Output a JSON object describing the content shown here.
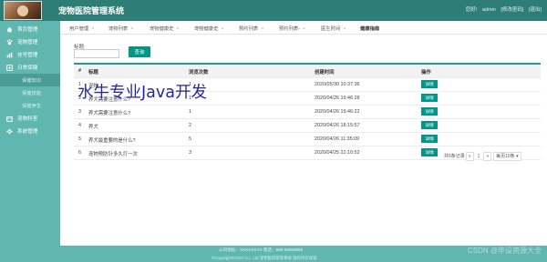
{
  "header": {
    "title": "宠物医院管理系统",
    "links": [
      "您好!",
      "admin",
      "[修改密码]",
      "[退出]"
    ]
  },
  "sidebar": {
    "items": [
      {
        "label": "首页管理",
        "icon": "home-icon"
      },
      {
        "label": "宠物管理",
        "icon": "paw-icon"
      },
      {
        "label": "挂号管理",
        "icon": "register-icon"
      },
      {
        "label": "日常保健",
        "icon": "health-icon"
      }
    ],
    "subitems": [
      "保健知识",
      "保健技能",
      "保健养生"
    ],
    "items_after": [
      {
        "label": "宠物科室",
        "icon": "department-icon"
      },
      {
        "label": "系统管理",
        "icon": "settings-icon"
      }
    ]
  },
  "tabs": [
    {
      "label": "用户管理"
    },
    {
      "label": "宠物列表"
    },
    {
      "label": "宠物健康史"
    },
    {
      "label": "宠物健康史"
    },
    {
      "label": "预约列表"
    },
    {
      "label": "预约列表-"
    },
    {
      "label": "医生时间"
    },
    {
      "label": "健康指南"
    }
  ],
  "search": {
    "label": "标题:",
    "value": "",
    "placeholder": "",
    "button": "查询"
  },
  "table": {
    "headers": [
      "#",
      "标题",
      "浏览次数",
      "创建时间",
      "操作"
    ],
    "rows": [
      {
        "no": "1",
        "title": "宠物",
        "views": "1",
        "time": "2020/05/30 10:37:36",
        "action": "详情"
      },
      {
        "no": "2",
        "title": "养犬需要注意什么?",
        "views": "1",
        "time": "2020/04/26 19:46:28",
        "action": "详情"
      },
      {
        "no": "3",
        "title": "养犬需要注意什么?",
        "views": "1",
        "time": "2020/04/26 19:46:22",
        "action": "详情"
      },
      {
        "no": "4",
        "title": "养犬",
        "views": "2",
        "time": "2020/04/26 18:15:57",
        "action": "详情"
      },
      {
        "no": "5",
        "title": "养犬最重要的是什么?",
        "views": "5",
        "time": "2020/04/26 11:35:09",
        "action": "详情"
      },
      {
        "no": "6",
        "title": "宠物预防针多久打一次",
        "views": "3",
        "time": "2020/04/25 22:10:52",
        "action": "详情"
      }
    ]
  },
  "pager": {
    "total": "共6条记录",
    "prev": "«",
    "current": "1",
    "next": "»",
    "per_page": "每页10条 ▾"
  },
  "watermark": {
    "java": "水牛专业Java开发",
    "csdn": "CSDN @毕设资源大全"
  },
  "footer": {
    "line1": "公司地址：XXXXXXXX 电话：888-88888888",
    "line2": "©Copyright©2020 Co., Ltd 宠物医院管理系统 版权所有保留"
  },
  "colors": {
    "header": "#2f7d77",
    "sidebar": "#5fb7b0",
    "accent": "#009688"
  }
}
